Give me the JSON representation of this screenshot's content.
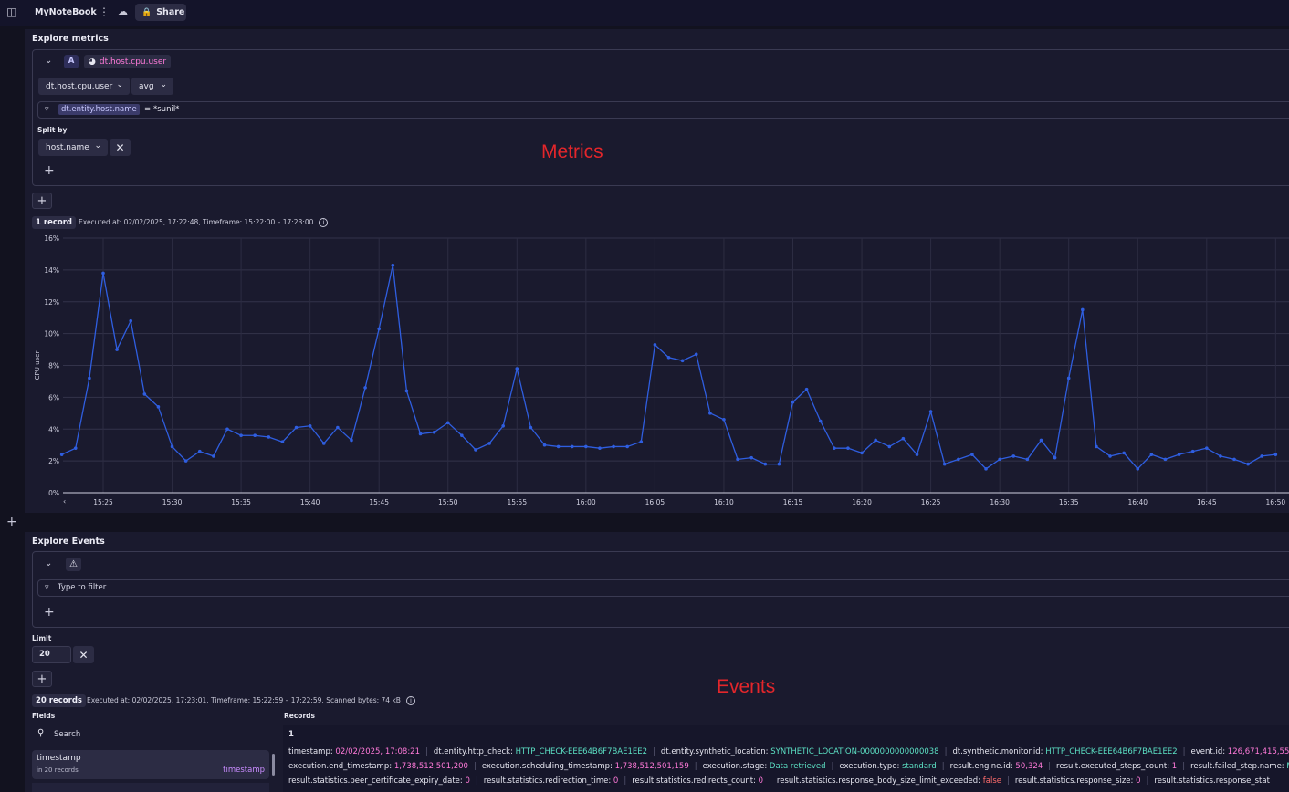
{
  "topbar": {
    "app_title": "MyNoteBook",
    "share_label": "Share"
  },
  "metrics_section": {
    "title": "Explore metrics",
    "query_letter": "A",
    "metric_chip": "dt.host.cpu.user",
    "metric_select": "dt.host.cpu.user",
    "aggregation_select": "avg",
    "filter_key": "dt.entity.host.name",
    "filter_op": "=",
    "filter_value": "*sunil*",
    "split_by_label": "Split by",
    "split_by_value": "host.name",
    "records_badge": "1 record",
    "executed_text": "Executed at: 02/02/2025, 17:22:48, Timeframe: 15:22:00 – 17:23:00",
    "overlay_label": "Metrics"
  },
  "chart_data": {
    "type": "line",
    "ylabel": "CPU user",
    "xlabel": "",
    "ylim": [
      0,
      16
    ],
    "y_ticks": [
      "0%",
      "2%",
      "4%",
      "6%",
      "8%",
      "10%",
      "12%",
      "14%",
      "16%"
    ],
    "x_ticks": [
      "15:25",
      "15:30",
      "15:35",
      "15:40",
      "15:45",
      "15:50",
      "15:55",
      "16:00",
      "16:05",
      "16:10",
      "16:15",
      "16:20",
      "16:25",
      "16:30",
      "16:35",
      "16:40",
      "16:45",
      "16:50"
    ],
    "x_start_label": "15:22",
    "series": [
      {
        "name": "",
        "color": "#2f5ee0",
        "values": [
          2.4,
          2.8,
          7.2,
          13.8,
          9.0,
          10.8,
          6.2,
          5.4,
          2.9,
          2.0,
          2.6,
          2.3,
          4.0,
          3.6,
          3.6,
          3.5,
          3.2,
          4.1,
          4.2,
          3.1,
          4.1,
          3.3,
          6.6,
          10.3,
          14.3,
          6.4,
          3.7,
          3.8,
          4.4,
          3.6,
          2.7,
          3.1,
          4.2,
          7.8,
          4.1,
          3.0,
          2.9,
          2.9,
          2.9,
          2.8,
          2.9,
          2.9,
          3.2,
          9.3,
          8.5,
          8.3,
          8.7,
          5.0,
          4.6,
          2.1,
          2.2,
          1.8,
          1.8,
          5.7,
          6.5,
          4.5,
          2.8,
          2.8,
          2.5,
          3.3,
          2.9,
          3.4,
          2.4,
          5.1,
          1.8,
          2.1,
          2.4,
          1.5,
          2.1,
          2.3,
          2.1,
          3.3,
          2.2,
          7.2,
          11.5,
          2.9,
          2.3,
          2.5,
          1.5,
          2.4,
          2.1,
          2.4,
          2.6,
          2.8,
          2.3,
          2.1,
          1.8,
          2.3,
          2.4
        ]
      }
    ]
  },
  "events_section": {
    "title": "Explore Events",
    "filter_placeholder": "Type to filter",
    "limit_label": "Limit",
    "limit_value": "20",
    "records_badge": "20 records",
    "executed_text": "Executed at: 02/02/2025, 17:23:01, Timeframe: 15:22:59 – 17:22:59, Scanned bytes: 74 kB",
    "overlay_label": "Events",
    "fields_label": "Fields",
    "search_placeholder": "Search",
    "field_item": {
      "name": "timestamp",
      "count": "in 20 records",
      "type": "timestamp"
    },
    "records_label": "Records",
    "record_index": "1",
    "record_rows": [
      [
        {
          "k": "timestamp:",
          "v": "02/02/2025, 17:08:21",
          "c": "pink"
        },
        {
          "k": "dt.entity.http_check:",
          "v": "HTTP_CHECK-EEE64B6F7BAE1EE2",
          "c": "teal"
        },
        {
          "k": "dt.entity.synthetic_location:",
          "v": "SYNTHETIC_LOCATION-0000000000000038",
          "c": "teal"
        },
        {
          "k": "dt.synthetic.monitor.id:",
          "v": "HTTP_CHECK-EEE64B6F7BAE1EE2",
          "c": "teal"
        },
        {
          "k": "event.id:",
          "v": "126,671,415,55",
          "c": "pink"
        }
      ],
      [
        {
          "k": "execution.end_timestamp:",
          "v": "1,738,512,501,200",
          "c": "pink"
        },
        {
          "k": "execution.scheduling_timestamp:",
          "v": "1,738,512,501,159",
          "c": "pink"
        },
        {
          "k": "execution.stage:",
          "v": "Data retrieved",
          "c": "teal"
        },
        {
          "k": "execution.type:",
          "v": "standard",
          "c": "teal"
        },
        {
          "k": "result.engine.id:",
          "v": "50,324",
          "c": "pink"
        },
        {
          "k": "result.executed_steps_count:",
          "v": "1",
          "c": "pink"
        },
        {
          "k": "result.failed_step.name:",
          "v": "My",
          "c": "teal"
        }
      ],
      [
        {
          "k": "result.statistics.peer_certificate_expiry_date:",
          "v": "0",
          "c": "pink"
        },
        {
          "k": "result.statistics.redirection_time:",
          "v": "0",
          "c": "pink"
        },
        {
          "k": "result.statistics.redirects_count:",
          "v": "0",
          "c": "pink"
        },
        {
          "k": "result.statistics.response_body_size_limit_exceeded:",
          "v": "false",
          "c": "red"
        },
        {
          "k": "result.statistics.response_size:",
          "v": "0",
          "c": "pink"
        },
        {
          "k": "result.statistics.response_stat",
          "v": "",
          "c": "pink"
        }
      ]
    ]
  }
}
